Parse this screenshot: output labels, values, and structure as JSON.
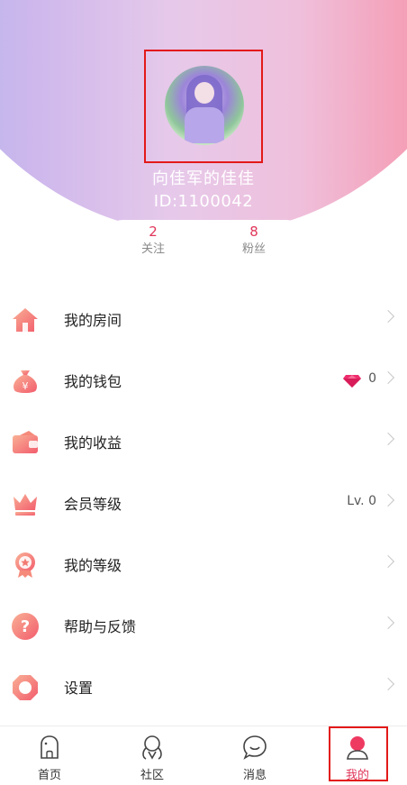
{
  "profile": {
    "username": "向佳军的佳佳",
    "user_id": "ID:1100042",
    "stats": [
      {
        "value": "2",
        "label": "关注"
      },
      {
        "value": "8",
        "label": "粉丝"
      }
    ]
  },
  "menu": [
    {
      "label": "我的房间",
      "icon": "house-icon"
    },
    {
      "label": "我的钱包",
      "icon": "money-bag-icon",
      "value": "0",
      "value_icon": "diamond-icon"
    },
    {
      "label": "我的收益",
      "icon": "wallet-icon"
    },
    {
      "label": "会员等级",
      "icon": "crown-icon",
      "value": "Lv. 0"
    },
    {
      "label": "我的等级",
      "icon": "medal-icon"
    },
    {
      "label": "帮助与反馈",
      "icon": "question-icon"
    },
    {
      "label": "设置",
      "icon": "settings-icon"
    }
  ],
  "tabbar": [
    {
      "label": "首页",
      "icon": "home-ghost-icon"
    },
    {
      "label": "社区",
      "icon": "community-icon"
    },
    {
      "label": "消息",
      "icon": "message-icon"
    },
    {
      "label": "我的",
      "icon": "profile-icon",
      "active": true
    }
  ],
  "colors": {
    "accent": "#e0365a",
    "icon_gradient_start": "#f7a08a",
    "icon_gradient_end": "#f35f6e"
  }
}
